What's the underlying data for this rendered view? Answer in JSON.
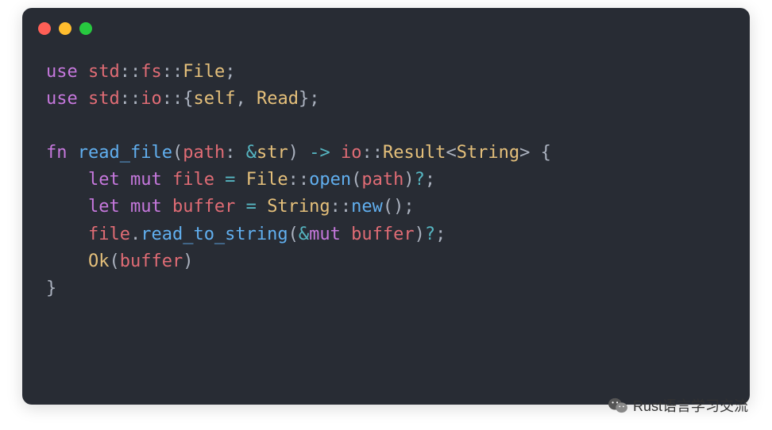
{
  "window": {
    "traffic_lights": [
      "red",
      "yellow",
      "green"
    ]
  },
  "code": {
    "lines": [
      [
        {
          "t": "use ",
          "c": "kw"
        },
        {
          "t": "std",
          "c": "path"
        },
        {
          "t": "::",
          "c": "punct"
        },
        {
          "t": "fs",
          "c": "path"
        },
        {
          "t": "::",
          "c": "punct"
        },
        {
          "t": "File",
          "c": "type"
        },
        {
          "t": ";",
          "c": "punct"
        }
      ],
      [
        {
          "t": "use ",
          "c": "kw"
        },
        {
          "t": "std",
          "c": "path"
        },
        {
          "t": "::",
          "c": "punct"
        },
        {
          "t": "io",
          "c": "path"
        },
        {
          "t": "::",
          "c": "punct"
        },
        {
          "t": "{",
          "c": "punct"
        },
        {
          "t": "self",
          "c": "selfkw"
        },
        {
          "t": ", ",
          "c": "punct"
        },
        {
          "t": "Read",
          "c": "type"
        },
        {
          "t": "};",
          "c": "punct"
        }
      ],
      [],
      [
        {
          "t": "fn ",
          "c": "kw"
        },
        {
          "t": "read_file",
          "c": "fn-name"
        },
        {
          "t": "(",
          "c": "punct"
        },
        {
          "t": "path",
          "c": "param"
        },
        {
          "t": ": ",
          "c": "punct"
        },
        {
          "t": "&",
          "c": "op"
        },
        {
          "t": "str",
          "c": "type"
        },
        {
          "t": ") ",
          "c": "punct"
        },
        {
          "t": "-> ",
          "c": "op"
        },
        {
          "t": "io",
          "c": "path"
        },
        {
          "t": "::",
          "c": "punct"
        },
        {
          "t": "Result",
          "c": "type"
        },
        {
          "t": "<",
          "c": "punct"
        },
        {
          "t": "String",
          "c": "type"
        },
        {
          "t": "> {",
          "c": "punct"
        }
      ],
      [
        {
          "t": "    ",
          "c": "punct"
        },
        {
          "t": "let ",
          "c": "kw"
        },
        {
          "t": "mut ",
          "c": "kw"
        },
        {
          "t": "file",
          "c": "ident"
        },
        {
          "t": " = ",
          "c": "op"
        },
        {
          "t": "File",
          "c": "type"
        },
        {
          "t": "::",
          "c": "punct"
        },
        {
          "t": "open",
          "c": "method"
        },
        {
          "t": "(",
          "c": "punct"
        },
        {
          "t": "path",
          "c": "ident"
        },
        {
          "t": ")",
          "c": "punct"
        },
        {
          "t": "?",
          "c": "op"
        },
        {
          "t": ";",
          "c": "punct"
        }
      ],
      [
        {
          "t": "    ",
          "c": "punct"
        },
        {
          "t": "let ",
          "c": "kw"
        },
        {
          "t": "mut ",
          "c": "kw"
        },
        {
          "t": "buffer",
          "c": "ident"
        },
        {
          "t": " = ",
          "c": "op"
        },
        {
          "t": "String",
          "c": "type"
        },
        {
          "t": "::",
          "c": "punct"
        },
        {
          "t": "new",
          "c": "method"
        },
        {
          "t": "();",
          "c": "punct"
        }
      ],
      [
        {
          "t": "    ",
          "c": "punct"
        },
        {
          "t": "file",
          "c": "ident"
        },
        {
          "t": ".",
          "c": "punct"
        },
        {
          "t": "read_to_string",
          "c": "method"
        },
        {
          "t": "(",
          "c": "punct"
        },
        {
          "t": "&",
          "c": "op"
        },
        {
          "t": "mut ",
          "c": "kw"
        },
        {
          "t": "buffer",
          "c": "ident"
        },
        {
          "t": ")",
          "c": "punct"
        },
        {
          "t": "?",
          "c": "op"
        },
        {
          "t": ";",
          "c": "punct"
        }
      ],
      [
        {
          "t": "    ",
          "c": "punct"
        },
        {
          "t": "Ok",
          "c": "type"
        },
        {
          "t": "(",
          "c": "punct"
        },
        {
          "t": "buffer",
          "c": "ident"
        },
        {
          "t": ")",
          "c": "punct"
        }
      ],
      [
        {
          "t": "}",
          "c": "punct"
        }
      ]
    ]
  },
  "watermark": {
    "text": "Rust语言学习交流",
    "icon": "wechat-icon"
  }
}
